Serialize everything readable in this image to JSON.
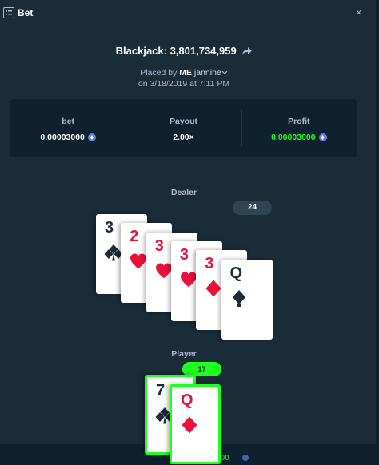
{
  "header": {
    "title": "Bet",
    "icon": "bet-list-icon",
    "close_icon": "close-icon",
    "close_symbol": "×"
  },
  "bet": {
    "game_title": "Blackjack: 3,801,734,959",
    "placed_by_prefix": "Placed by",
    "placed_by_me": "ME",
    "username": "jannine",
    "date_line": "on 3/18/2019 at 7:11 PM"
  },
  "stats": [
    {
      "label": "bet",
      "value": "0.00003000",
      "currency_icon": "eth-icon",
      "color": "#ffffff"
    },
    {
      "label": "Payout",
      "value": "2.00×",
      "color": "#ffffff"
    },
    {
      "label": "Profit",
      "value": "0.00003000",
      "currency_icon": "eth-icon",
      "color": "#1fff20"
    }
  ],
  "dealer": {
    "label": "Dealer",
    "total": "24",
    "cards": [
      {
        "rank": "3",
        "suit": "clubs",
        "color": "black"
      },
      {
        "rank": "2",
        "suit": "hearts",
        "color": "red"
      },
      {
        "rank": "3",
        "suit": "hearts",
        "color": "red"
      },
      {
        "rank": "3",
        "suit": "hearts",
        "color": "red"
      },
      {
        "rank": "3",
        "suit": "diamonds",
        "color": "red"
      },
      {
        "rank": "Q",
        "suit": "spades",
        "color": "black"
      }
    ]
  },
  "player": {
    "label": "Player",
    "total": "17",
    "result_color": "#1fff20",
    "cards": [
      {
        "rank": "7",
        "suit": "clubs",
        "color": "black"
      },
      {
        "rank": "Q",
        "suit": "diamonds",
        "color": "red"
      }
    ]
  },
  "footer": {
    "amount": "0.00003000"
  }
}
